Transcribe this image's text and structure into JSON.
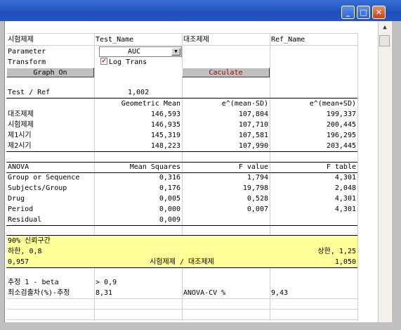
{
  "window": {
    "buttons": {
      "minimize": "_",
      "maximize": "□",
      "close": "✕"
    }
  },
  "header": {
    "col1": "시험제제",
    "col2": "Test_Name",
    "col3": "대조제제",
    "col4": "Ref_Name"
  },
  "parameter": {
    "label": "Parameter",
    "value": "AUC"
  },
  "transform": {
    "label": "Transform",
    "checkbox_label": "Log Trans"
  },
  "buttons": {
    "graph_on": "Graph On",
    "calculate": "Caculate"
  },
  "ratio": {
    "label": "Test / Ref",
    "value": "1,002"
  },
  "means": {
    "headers": [
      "Geometric Mean",
      "e^(mean-SD)",
      "e^(mean+SD)"
    ],
    "rows": [
      {
        "label": "대조제제",
        "values": [
          "146,593",
          "107,804",
          "199,337"
        ]
      },
      {
        "label": "시험제제",
        "values": [
          "146,935",
          "107,710",
          "200,445"
        ]
      },
      {
        "label": "제1시기",
        "values": [
          "145,319",
          "107,581",
          "196,295"
        ]
      },
      {
        "label": "제2시기",
        "values": [
          "148,223",
          "107,990",
          "203,445"
        ]
      }
    ]
  },
  "anova": {
    "headers": [
      "ANOVA",
      "Mean Squares",
      "F value",
      "F table"
    ],
    "rows": [
      {
        "label": "Group or Sequence",
        "values": [
          "0,316",
          "1,794",
          "4,301"
        ]
      },
      {
        "label": "Subjects/Group",
        "values": [
          "0,176",
          "19,798",
          "2,048"
        ]
      },
      {
        "label": "Drug",
        "values": [
          "0,005",
          "0,528",
          "4,301"
        ]
      },
      {
        "label": "Period",
        "values": [
          "0,000",
          "0,007",
          "4,301"
        ]
      },
      {
        "label": "Residual",
        "values": [
          "0,009",
          "",
          ""
        ]
      }
    ]
  },
  "ci": {
    "title": "90% 신뢰구간",
    "lower": "하한, 0,8",
    "upper": "상한, 1,25",
    "point": "0,957",
    "ratio_label": "시험제제 / 대조제제",
    "point_upper": "1,050"
  },
  "power": {
    "label": "추정 1 - beta",
    "value": "> 0,9"
  },
  "min_diff": {
    "label": "최소검출차(%)-추정",
    "value": "8,31",
    "cv_label": "ANOVA-CV %",
    "cv_value": "9,43"
  }
}
